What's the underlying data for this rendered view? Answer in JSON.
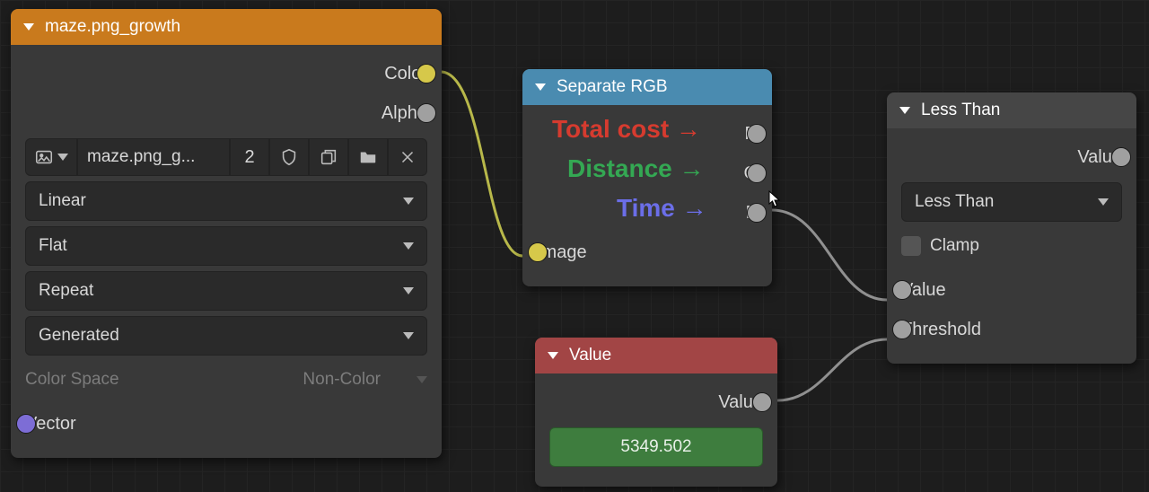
{
  "image_node": {
    "title": "maze.png_growth",
    "datablock": {
      "name": "maze.png_g...",
      "users": "2"
    },
    "interpolation": "Linear",
    "projection": "Flat",
    "extension": "Repeat",
    "source": "Generated",
    "color_space_label": "Color Space",
    "color_space_value": "Non-Color",
    "outputs": {
      "color": "Color",
      "alpha": "Alpha"
    },
    "inputs": {
      "vector": "Vector"
    }
  },
  "separate_rgb": {
    "title": "Separate RGB",
    "outputs": {
      "r": "R",
      "g": "G",
      "b": "B"
    },
    "inputs": {
      "image": "Image"
    },
    "annotations": {
      "r": "Total cost →",
      "g": "Distance →",
      "b": "Time →"
    }
  },
  "value_node": {
    "title": "Value",
    "outputs": {
      "value": "Value"
    },
    "numeric": "5349.502"
  },
  "less_than": {
    "title": "Less Than",
    "outputs": {
      "value": "Value"
    },
    "operation": "Less Than",
    "clamp": "Clamp",
    "inputs": {
      "value": "Value",
      "threshold": "Threshold"
    }
  }
}
